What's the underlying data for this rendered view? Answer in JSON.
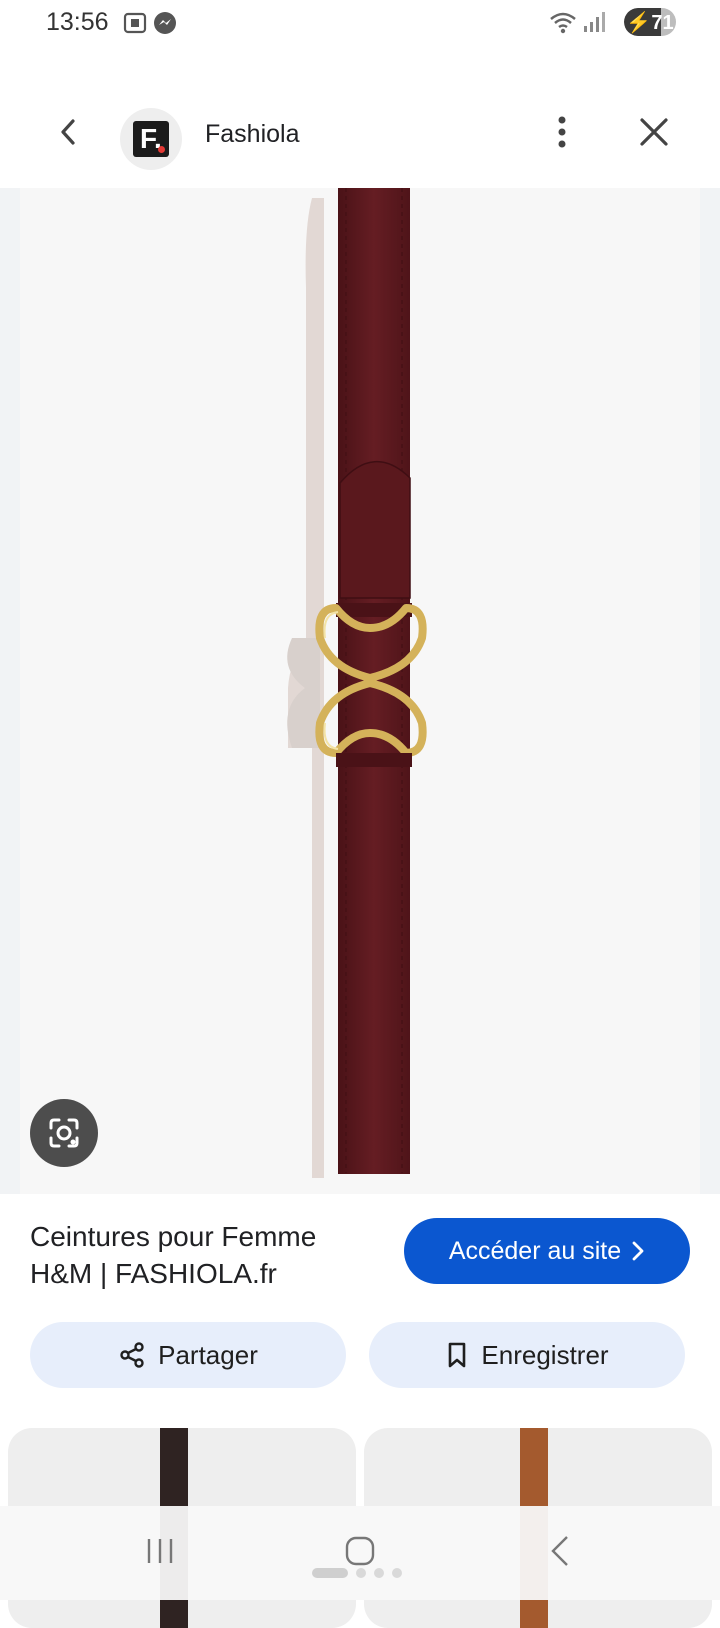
{
  "status_bar": {
    "time": "13:56",
    "battery": "71",
    "battery_level": 0.71,
    "icons": [
      "screenshot-icon",
      "messenger-icon",
      "wifi-icon",
      "signal-icon",
      "battery-charging-icon"
    ]
  },
  "header": {
    "site_name": "Fashiola",
    "logo_letter": "F."
  },
  "product": {
    "title_line1": "Ceintures pour Femme",
    "title_line2": "H&M | FASHIOLA.fr",
    "visit_label": "Accéder au site"
  },
  "actions": {
    "share_label": "Partager",
    "save_label": "Enregistrer"
  },
  "colors": {
    "accent": "#0b57d0",
    "pill_bg": "#e7eefb",
    "belt": "#5e1a1f",
    "buckle": "#d4b25a"
  }
}
